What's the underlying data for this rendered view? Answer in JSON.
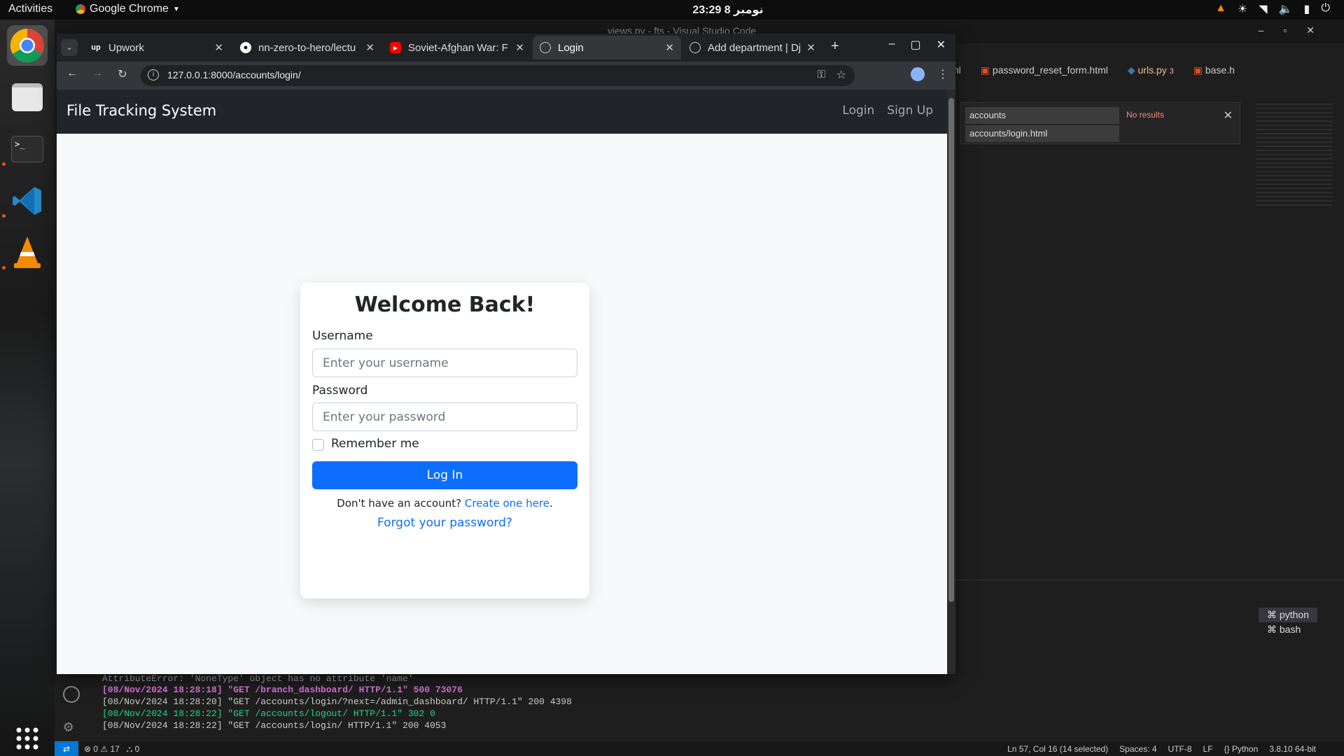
{
  "topbar": {
    "activities": "Activities",
    "app_name": "Google Chrome",
    "clock": "23:29  8 نومبر"
  },
  "chrome": {
    "tabs": [
      {
        "title": "Upwork",
        "icon": "upwork-icon"
      },
      {
        "title": "nn-zero-to-hero/lectu",
        "icon": "github-icon"
      },
      {
        "title": "Soviet-Afghan War: F",
        "icon": "youtube-icon"
      },
      {
        "title": "Login",
        "icon": "globe-icon",
        "active": true
      },
      {
        "title": "Add department | Dj",
        "icon": "globe-icon"
      }
    ],
    "url": "127.0.0.1:8000/accounts/login/"
  },
  "site": {
    "brand": "File Tracking System",
    "nav": {
      "login": "Login",
      "signup": "Sign Up"
    }
  },
  "login": {
    "heading": "Welcome Back!",
    "username_label": "Username",
    "username_placeholder": "Enter your username",
    "password_label": "Password",
    "password_placeholder": "Enter your password",
    "remember_label": "Remember me",
    "submit": "Log In",
    "no_account": "Don't have an account?",
    "create_link": "Create one here",
    "period": ".",
    "forgot": "Forgot your password?"
  },
  "vscode": {
    "title": "views.py - fts - Visual Studio Code",
    "tabs": [
      "ml",
      "password_reset_form.html",
      "urls.py",
      "3",
      "base.h"
    ],
    "find": {
      "query": "accounts",
      "result": "No results",
      "replace": "accounts/login.html"
    },
    "terminals": [
      "python",
      "bash"
    ],
    "terminal_lines": [
      "AttributeError: 'NoneType' object has no attribute 'name'",
      "[08/Nov/2024 18:28:18] \"GET /branch_dashboard/ HTTP/1.1\" 500 73076",
      "[08/Nov/2024 18:28:20] \"GET /accounts/login/?next=/admin_dashboard/ HTTP/1.1\" 200 4398",
      "[08/Nov/2024 18:28:22] \"GET /accounts/logout/ HTTP/1.1\" 302 0",
      "[08/Nov/2024 18:28:22] \"GET /accounts/login/ HTTP/1.1\" 200 4053"
    ],
    "status": {
      "problems": "⊗ 0 ⚠ 17",
      "ports": "0",
      "position": "Ln 57, Col 16 (14 selected)",
      "spaces": "Spaces: 4",
      "encoding": "UTF-8",
      "eol": "LF",
      "language": "Python",
      "interpreter": "3.8.10 64-bit"
    }
  },
  "colors": {
    "primary": "#0d6efd",
    "navbar": "#212529",
    "page_bg": "#f8f9fa"
  }
}
